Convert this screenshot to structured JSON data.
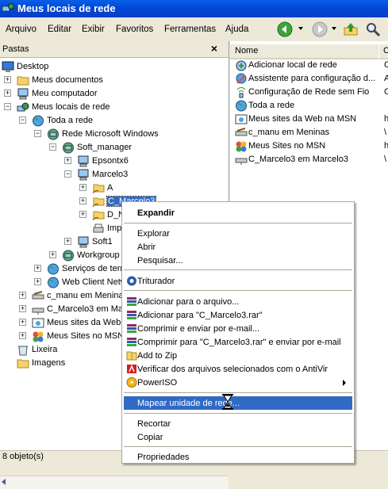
{
  "window": {
    "title": "Meus locais de rede"
  },
  "menu": [
    "Arquivo",
    "Editar",
    "Exibir",
    "Favoritos",
    "Ferramentas",
    "Ajuda"
  ],
  "left_pane": {
    "title": "Pastas",
    "close_glyph": "×"
  },
  "tree": [
    {
      "label": "Desktop",
      "icon": "desktop-icon"
    },
    {
      "label": "Meus documentos",
      "icon": "folder-icon"
    },
    {
      "label": "Meu computador",
      "icon": "computer-icon"
    },
    {
      "label": "Meus locais de rede",
      "icon": "network-places-icon"
    },
    {
      "label": "Toda a rede",
      "icon": "globe-icon"
    },
    {
      "label": "Rede Microsoft Windows",
      "icon": "network-icon"
    },
    {
      "label": "Soft_manager",
      "icon": "network-icon"
    },
    {
      "label": "Epsontx6",
      "icon": "computer-icon"
    },
    {
      "label": "Marcelo3",
      "icon": "computer-icon"
    },
    {
      "label": "A",
      "icon": "shared-folder-icon"
    },
    {
      "label": "C_Marcelo3",
      "icon": "shared-folder-icon"
    },
    {
      "label": "D_N",
      "icon": "shared-folder-icon"
    },
    {
      "label": "Imp",
      "icon": "printer-icon"
    },
    {
      "label": "Soft1",
      "icon": "computer-icon"
    },
    {
      "label": "Workgroup",
      "icon": "network-icon"
    },
    {
      "label": "Serviços de term",
      "icon": "globe-icon"
    },
    {
      "label": "Web Client Netw",
      "icon": "globe-icon"
    },
    {
      "label": "c_manu em Meninas",
      "icon": "network-drive-icon"
    },
    {
      "label": "C_Marcelo3 em Mar",
      "icon": "network-drive-icon"
    },
    {
      "label": "Meus sites da Web",
      "icon": "web-folder-icon"
    },
    {
      "label": "Meus Sites no MSN",
      "icon": "msn-icon"
    },
    {
      "label": "Lixeira",
      "icon": "recycle-bin-icon"
    },
    {
      "label": "Imagens",
      "icon": "folder-icon"
    }
  ],
  "right_pane": {
    "col_name": "Nome",
    "col2": "C",
    "items": [
      {
        "label": "Adicionar local de rede",
        "icon": "add-network-place-icon",
        "col2": "C"
      },
      {
        "label": "Assistente para configuração d...",
        "icon": "wizard-icon",
        "col2": "A"
      },
      {
        "label": "Configuração de Rede sem Fio",
        "icon": "wireless-icon",
        "col2": "C"
      },
      {
        "label": "Toda a rede",
        "icon": "globe-icon",
        "col2": ""
      },
      {
        "label": "Meus sites da Web na MSN",
        "icon": "web-folder-icon",
        "col2": "h"
      },
      {
        "label": "c_manu em Meninas",
        "icon": "network-drive-icon",
        "col2": "\\"
      },
      {
        "label": "Meus Sites no MSN",
        "icon": "msn-icon",
        "col2": "h"
      },
      {
        "label": "C_Marcelo3 em Marcelo3",
        "icon": "network-drive-icon",
        "col2": "\\"
      }
    ]
  },
  "context_menu": [
    {
      "label": "Expandir",
      "icon": "",
      "bold": true
    },
    {
      "sep": true
    },
    {
      "label": "Explorar",
      "icon": ""
    },
    {
      "label": "Abrir",
      "icon": ""
    },
    {
      "label": "Pesquisar...",
      "icon": ""
    },
    {
      "sep": true
    },
    {
      "label": "Triturador",
      "icon": "shredder-icon"
    },
    {
      "sep": true
    },
    {
      "label": "Adicionar para o arquivo...",
      "icon": "winrar-icon"
    },
    {
      "label": "Adicionar para \"C_Marcelo3.rar\"",
      "icon": "winrar-icon"
    },
    {
      "label": "Comprimir e enviar por e-mail...",
      "icon": "winrar-icon"
    },
    {
      "label": "Comprimir para \"C_Marcelo3.rar\" e enviar por e-mail",
      "icon": "winrar-icon"
    },
    {
      "label": "Add to Zip",
      "icon": "zip-icon"
    },
    {
      "label": "Verificar dos arquivos selecionados com o AntiVir",
      "icon": "antivir-icon"
    },
    {
      "label": "PowerISO",
      "icon": "poweriso-icon",
      "submenu": true
    },
    {
      "sep": true
    },
    {
      "label": "Mapear unidade de rede...",
      "icon": "",
      "highlighted": true
    },
    {
      "sep": true
    },
    {
      "label": "Recortar",
      "icon": ""
    },
    {
      "label": "Copiar",
      "icon": ""
    },
    {
      "sep": true
    },
    {
      "label": "Propriedades",
      "icon": ""
    }
  ],
  "status": {
    "text": "8 objeto(s)"
  },
  "colors": {
    "title_bar": "#0A5FE8",
    "selection": "#316AC5",
    "chrome": "#ECE9D8"
  }
}
